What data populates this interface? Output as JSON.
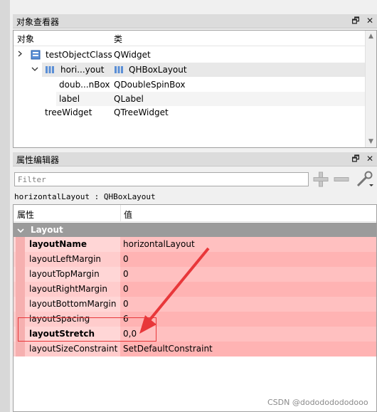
{
  "object_inspector": {
    "title": "对象查看器",
    "columns": [
      "对象",
      "类"
    ],
    "rows": [
      {
        "object": "testObjectClass",
        "class": "QWidget"
      },
      {
        "object": "hori...yout",
        "class": "QHBoxLayout"
      },
      {
        "object": "doub...nBox",
        "class": "QDoubleSpinBox"
      },
      {
        "object": "label",
        "class": "QLabel"
      },
      {
        "object": "treeWidget",
        "class": "QTreeWidget"
      }
    ]
  },
  "property_editor": {
    "title": "属性编辑器",
    "filter_placeholder": "Filter",
    "object_path": "horizontalLayout : QHBoxLayout",
    "columns": [
      "属性",
      "值"
    ],
    "group": "Layout",
    "properties": [
      {
        "name": "layoutName",
        "value": "horizontalLayout",
        "bold": true
      },
      {
        "name": "layoutLeftMargin",
        "value": "0"
      },
      {
        "name": "layoutTopMargin",
        "value": "0"
      },
      {
        "name": "layoutRightMargin",
        "value": "0"
      },
      {
        "name": "layoutBottomMargin",
        "value": "0"
      },
      {
        "name": "layoutSpacing",
        "value": "6"
      },
      {
        "name": "layoutStretch",
        "value": "0,0",
        "bold": true
      },
      {
        "name": "layoutSizeConstraint",
        "value": "SetDefaultConstraint"
      }
    ]
  },
  "title_buttons": {
    "float": "🗗",
    "close": "✕"
  },
  "watermark": "CSDN @dodododododooo",
  "colors": {
    "annotation": "#e8373a",
    "row_name_bg": "#ffd6d6",
    "row_value_bg": "#ffc0c0",
    "group_bg": "#9b9b9b"
  }
}
